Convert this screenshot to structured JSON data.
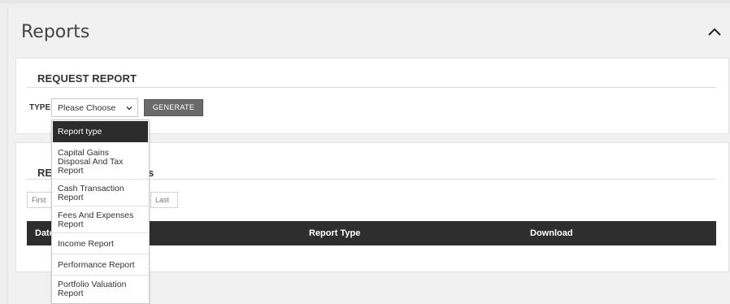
{
  "panel": {
    "title": "Reports",
    "collapse_icon": "chevron-up-icon"
  },
  "request_report": {
    "heading": "REQUEST REPORT",
    "type_label": "TYPE",
    "select_value": "Please Choose",
    "select_icon": "chevron-down-icon",
    "generate_label": "GENERATE"
  },
  "dropdown": {
    "header": "Report type",
    "options": [
      "Capital Gains Disposal And Tax Report",
      "Cash Transaction Report",
      "Fees And Expenses Report",
      "Income Report",
      "Performance Report",
      "Portfolio Valuation Report"
    ]
  },
  "reports_list": {
    "heading_visible": "RE",
    "heading_tail_visible": "s",
    "pager_first": "First",
    "pager_last": "Last",
    "columns": {
      "date": "Date",
      "report_type": "Report Type",
      "download": "Download"
    }
  },
  "colors": {
    "page_bg": "#efefef",
    "card_bg": "#ffffff",
    "header_dark": "#2e2e2e",
    "button": "#6a6a6a"
  }
}
